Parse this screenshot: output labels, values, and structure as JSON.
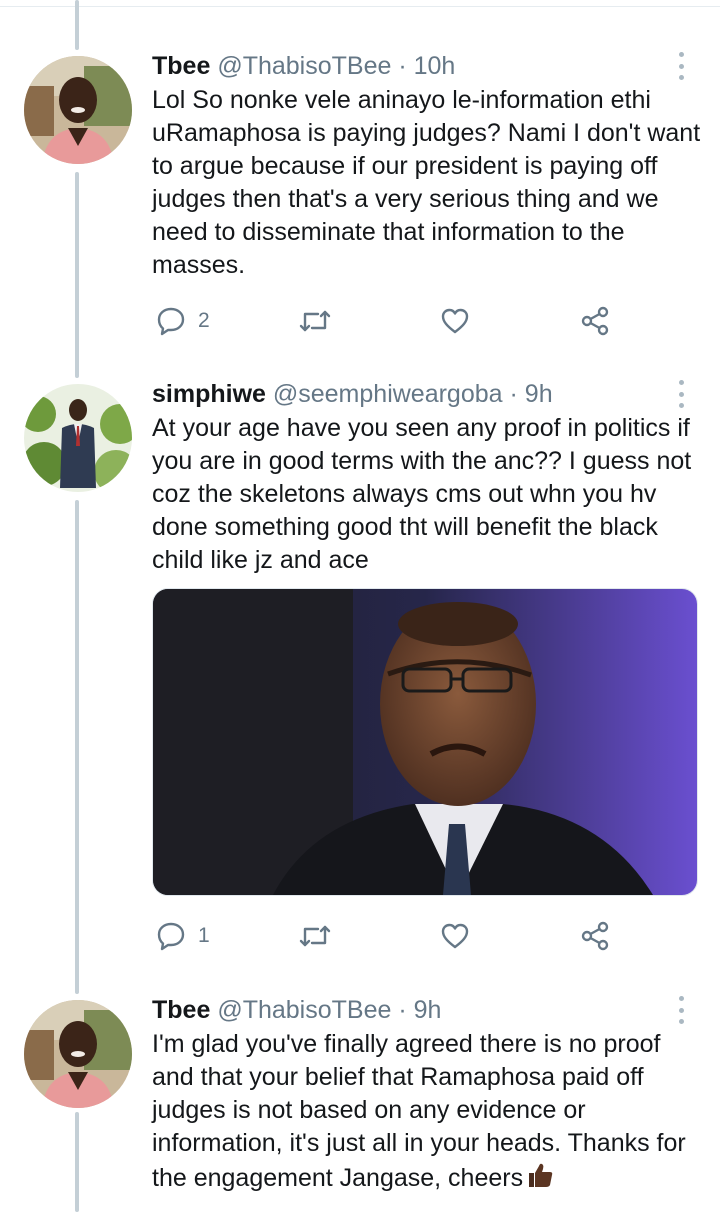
{
  "tweets": [
    {
      "name": "Tbee",
      "handle": "@ThabisoTBee",
      "separator": "·",
      "time": "10h",
      "text": "Lol So nonke vele aninayo le-information ethi uRamaphosa is paying judges? Nami I don't want to argue because if our president is paying off judges then that's a very serious thing and we need to disseminate that information to the masses.",
      "reply_count": "2"
    },
    {
      "name": "simphiwe",
      "handle": "@seemphiweargoba",
      "separator": "·",
      "time": "9h",
      "text": "At your age have you seen any proof in politics if you are in good terms with the anc?? I guess not coz the skeletons  always cms out whn you hv done something good tht will benefit the black child like jz and ace",
      "reply_count": "1"
    },
    {
      "name": "Tbee",
      "handle": "@ThabisoTBee",
      "separator": "·",
      "time": "9h",
      "text": "I'm glad you've finally agreed there is no proof and that your belief that Ramaphosa paid off judges is not based on any evidence or information, it's just all in your heads. Thanks for the engagement Jangase, cheers"
    }
  ],
  "icons": {
    "reply": "reply-icon",
    "retweet": "retweet-icon",
    "like": "heart-icon",
    "share": "share-icon",
    "more": "more-options-icon",
    "emoji": "thumbs-up-emoji"
  },
  "colors": {
    "text": "#14171a",
    "secondary": "#657786",
    "thread_line": "#c4cfd6",
    "icon": "#657786"
  }
}
